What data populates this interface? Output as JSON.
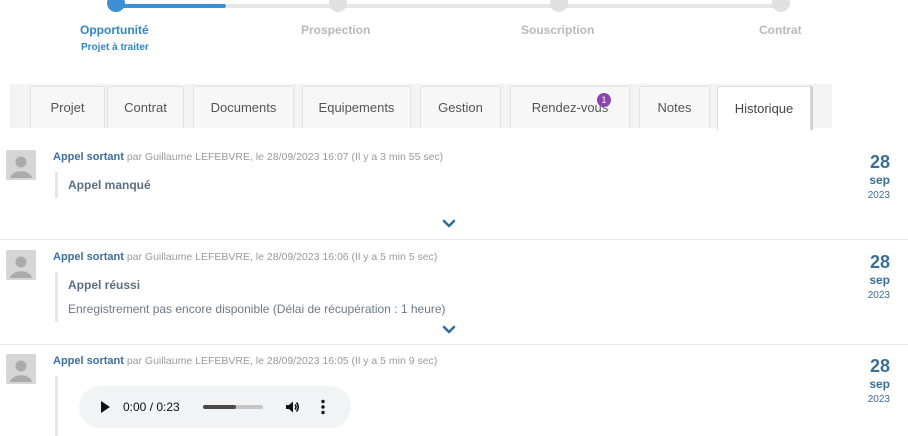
{
  "stepper": {
    "steps": [
      {
        "label": "Opportunité",
        "active": true
      },
      {
        "label": "Prospection",
        "active": false
      },
      {
        "label": "Souscription",
        "active": false
      },
      {
        "label": "Contrat",
        "active": false
      }
    ],
    "sublabel": "Projet à traiter",
    "active_color": "#3a8fd6"
  },
  "tabs": [
    {
      "label": "Projet"
    },
    {
      "label": "Contrat"
    },
    {
      "label": "Documents"
    },
    {
      "label": "Equipements"
    },
    {
      "label": "Gestion"
    },
    {
      "label": "Rendez-vous",
      "badge": "1"
    },
    {
      "label": "Notes"
    },
    {
      "label": "Historique",
      "active": true
    }
  ],
  "history": [
    {
      "type": "Appel sortant",
      "by": "par Guillaume LEFEBVRE, le 28/09/2023 16:07 (Il y a 3 min 55 sec)",
      "title": "Appel manqué",
      "text": "",
      "date": {
        "day": "28",
        "month": "sep",
        "year": "2023"
      }
    },
    {
      "type": "Appel sortant",
      "by": "par Guillaume LEFEBVRE, le 28/09/2023 16:06 (Il y a 5 min 5 sec)",
      "title": "Appel réussi",
      "text": "Enregistrement pas encore disponible (Délai de récupération : 1 heure)",
      "date": {
        "day": "28",
        "month": "sep",
        "year": "2023"
      }
    },
    {
      "type": "Appel sortant",
      "by": "par Guillaume LEFEBVRE, le 28/09/2023 16:05 (Il y a 5 min 9 sec)",
      "date": {
        "day": "28",
        "month": "sep",
        "year": "2023"
      },
      "audio": {
        "time": "0:00 / 0:23",
        "progress": 0.55
      }
    }
  ],
  "icons": {
    "avatar": "user-avatar-icon",
    "expand": "chevron-down-icon",
    "play": "play-icon",
    "volume": "volume-icon",
    "more": "more-vertical-icon"
  },
  "colors": {
    "accent": "#3a8fd6",
    "badge": "#8e44ad",
    "date": "#3a6f9a"
  }
}
